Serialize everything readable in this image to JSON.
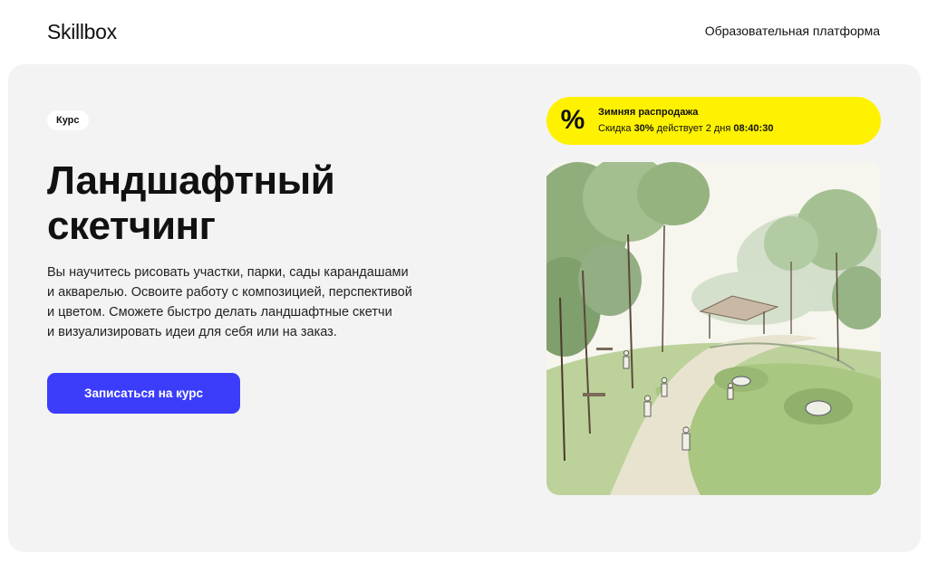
{
  "header": {
    "logo": "Skillbox",
    "platform_link": "Образовательная платформа"
  },
  "hero": {
    "badge": "Курс",
    "title_lines": [
      "Ландшафтный",
      "скетчинг"
    ],
    "description_lines": [
      "Вы научитесь рисовать участки, парки, сады карандашами",
      "и акварелью. Освоите работу с композицией, перспективой",
      "и цветом. Сможете быстро делать ландшафтные скетчи",
      "и визуализировать идеи для себя или на заказ."
    ],
    "cta_label": "Записаться на курс"
  },
  "sale": {
    "icon": "percent-icon",
    "icon_glyph": "%",
    "title": "Зимняя распродажа",
    "prefix": "Скидка",
    "discount": "30%",
    "middle": "действует",
    "duration": "2 дня",
    "countdown": "08:40:30"
  },
  "illustration": {
    "icon": "landscape-sketch-image"
  },
  "colors": {
    "accent": "#3b3dfb",
    "sale_background": "#fff200",
    "hero_background": "#f3f3f3"
  }
}
